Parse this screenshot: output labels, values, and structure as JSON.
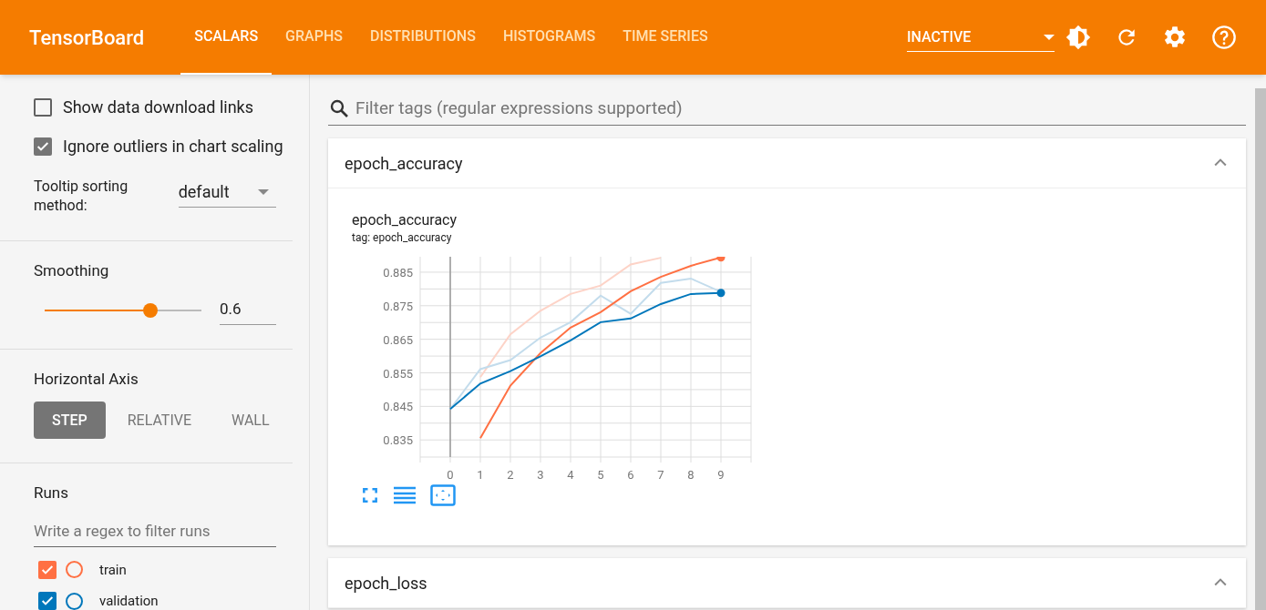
{
  "header": {
    "title": "TensorBoard",
    "tabs": [
      {
        "label": "SCALARS",
        "selected": true
      },
      {
        "label": "GRAPHS",
        "selected": false
      },
      {
        "label": "DISTRIBUTIONS",
        "selected": false
      },
      {
        "label": "HISTOGRAMS",
        "selected": false
      },
      {
        "label": "TIME SERIES",
        "selected": false
      }
    ],
    "plugin_select": "INACTIVE"
  },
  "sidebar": {
    "options": [
      {
        "label": "Show data download links",
        "checked": false
      },
      {
        "label": "Ignore outliers in chart scaling",
        "checked": true
      }
    ],
    "tooltip_sorting": {
      "label": "Tooltip sorting method:",
      "value": "default"
    },
    "smoothing": {
      "label": "Smoothing",
      "level": 0.6,
      "value": "0.6"
    },
    "horizontal_axis": {
      "label": "Horizontal Axis",
      "options": [
        {
          "label": "STEP",
          "selected": true
        },
        {
          "label": "RELATIVE",
          "selected": false
        },
        {
          "label": "WALL",
          "selected": false
        }
      ]
    },
    "runs": {
      "label": "Runs",
      "filter_placeholder": "Write a regex to filter runs",
      "items": [
        {
          "name": "train",
          "checked": true,
          "color": "#ff7043"
        },
        {
          "name": "validation",
          "checked": true,
          "color": "#0077bb"
        }
      ]
    }
  },
  "main": {
    "filter_placeholder": "Filter tags (regular expressions supported)",
    "sections": [
      {
        "title": "epoch_accuracy",
        "expanded": true,
        "card": {
          "title": "epoch_accuracy",
          "subtitle": "tag: epoch_accuracy",
          "chart_data": {
            "type": "line",
            "grid": true,
            "x": [
              0,
              1,
              2,
              3,
              4,
              5,
              6,
              7,
              8,
              9
            ],
            "xlim": [
              -1,
              10
            ],
            "ylim": [
              0.8299,
              0.8896
            ],
            "xticks": [
              0,
              1,
              2,
              3,
              4,
              5,
              6,
              7,
              8,
              9
            ],
            "yticks": [
              0.835,
              0.845,
              0.855,
              0.865,
              0.875,
              0.885
            ],
            "series": [
              {
                "color": "#fdd3c7",
                "values": [
                  null,
                  0.8537,
                  0.8665,
                  0.8735,
                  0.8785,
                  0.881,
                  0.8873,
                  0.8893,
                  null,
                  null
                ]
              },
              {
                "color": "#c3dcec",
                "values": [
                  0.8442,
                  0.8561,
                  0.8588,
                  0.8655,
                  0.8701,
                  0.878,
                  0.8726,
                  0.8818,
                  0.8831,
                  0.8791
                ]
              },
              {
                "color": "#ff7043",
                "values": [
                  null,
                  0.8355,
                  0.8512,
                  0.8609,
                  0.8685,
                  0.8731,
                  0.8793,
                  0.8836,
                  0.8869,
                  0.8894
                ]
              },
              {
                "color": "#0077bb",
                "values": [
                  0.8442,
                  0.8518,
                  0.8555,
                  0.8599,
                  0.8647,
                  0.8701,
                  0.8712,
                  0.8755,
                  0.8785,
                  0.8788
                ]
              }
            ]
          }
        }
      },
      {
        "title": "epoch_loss",
        "expanded": true
      }
    ]
  }
}
